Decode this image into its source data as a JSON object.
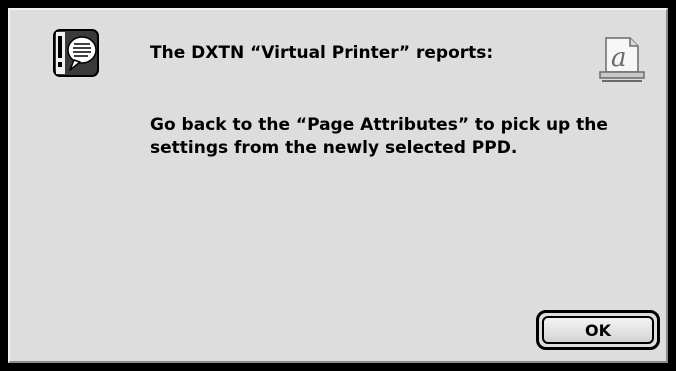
{
  "dialog": {
    "title_text": "The DXTN “Virtual Printer” reports:",
    "message_line1": "Go back to the “Page Attributes” to pick up the",
    "message_line2": "settings from the newly selected PPD.",
    "ok_label": "OK",
    "alert_icon": "alert-note-icon",
    "app_icon": "printer-document-icon"
  },
  "colors": {
    "background": "#dddddd",
    "frame": "#000000",
    "text": "#000000"
  }
}
